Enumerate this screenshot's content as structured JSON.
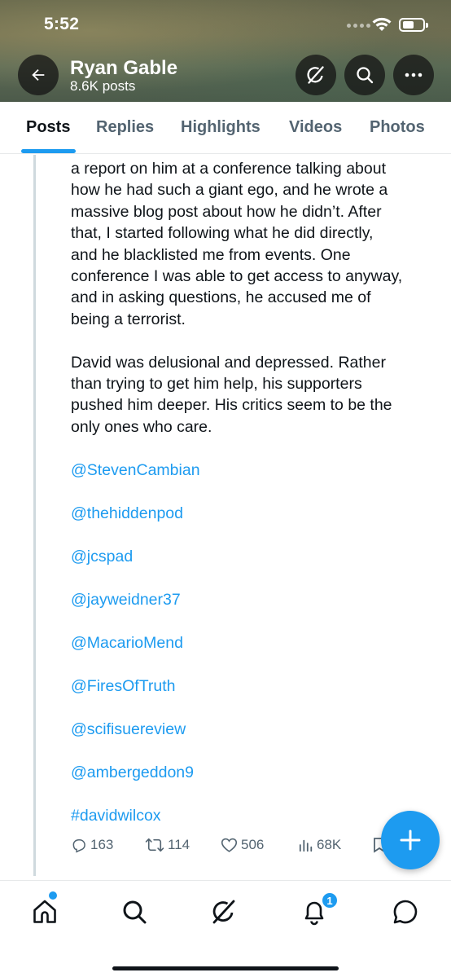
{
  "status_bar": {
    "time": "5:52"
  },
  "profile": {
    "name": "Ryan Gable",
    "posts_count": "8.6K posts"
  },
  "tabs": [
    {
      "label": "Posts",
      "active": true
    },
    {
      "label": "Replies",
      "active": false
    },
    {
      "label": "Highlights",
      "active": false
    },
    {
      "label": "Videos",
      "active": false
    },
    {
      "label": "Photos",
      "active": false
    }
  ],
  "post": {
    "paragraph1_lines": [
      "a report on him at a conference talking about",
      "how he had such a giant ego, and he wrote a",
      "massive blog post about how he didn’t. After",
      "that, I started following what he did directly,",
      "and he blacklisted me from events. One",
      "conference I was able to get access to anyway,",
      "and in asking questions, he accused me of",
      "being a terrorist."
    ],
    "paragraph2_lines": [
      "David was delusional and depressed. Rather",
      "than trying to get him help, his supporters",
      "pushed him deeper. His critics seem to be the",
      "only ones who care."
    ],
    "mentions": [
      "@StevenCambian",
      "@thehiddenpod",
      "@jcspad",
      "@jayweidner37",
      "@MacarioMend",
      "@FiresOfTruth",
      "@scifisuereview",
      "@ambergeddon9"
    ],
    "hashtag": "#davidwilcox",
    "stats": {
      "replies": "163",
      "reposts": "114",
      "likes": "506",
      "views": "68K"
    }
  },
  "notifications": {
    "badge_count": "1"
  },
  "colors": {
    "accent": "#1d9bf0",
    "text": "#0f1419",
    "muted": "#536471"
  }
}
